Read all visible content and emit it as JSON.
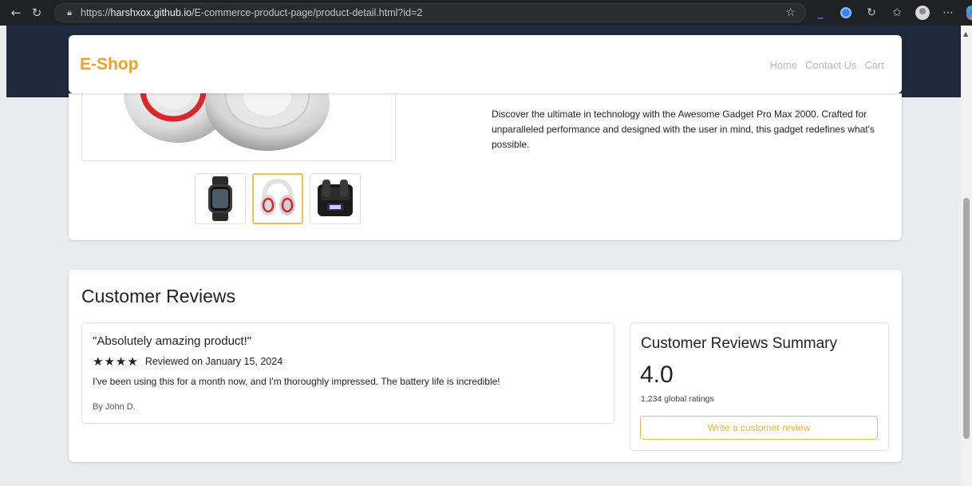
{
  "browser": {
    "url_prefix": "https://",
    "url_host": "harshxox.github.io",
    "url_path": "/E-commerce-product-page/product-detail.html?id=2"
  },
  "navbar": {
    "brand": "E-Shop",
    "links": [
      "Home",
      "Contact Us",
      "Cart"
    ]
  },
  "product": {
    "description": "Discover the ultimate in technology with the Awesome Gadget Pro Max 2000. Crafted for unparalleled performance and designed with the user in mind, this gadget redefines what's possible."
  },
  "reviews": {
    "title": "Customer Reviews",
    "items": [
      {
        "headline": "\"Absolutely amazing product!\"",
        "stars": 4,
        "date": "Reviewed on January 15, 2024",
        "body": "I've been using this for a month now, and I'm thoroughly impressed. The battery life is incredible!",
        "author": "By John D."
      }
    ],
    "summary": {
      "title": "Customer Reviews Summary",
      "rating": "4.0",
      "count": "1,234 global ratings",
      "write_label": "Write a customer review"
    }
  },
  "colors": {
    "brand": "#f0a024",
    "accent_border": "#f0c24a",
    "header_dark": "#1e2a3c"
  }
}
